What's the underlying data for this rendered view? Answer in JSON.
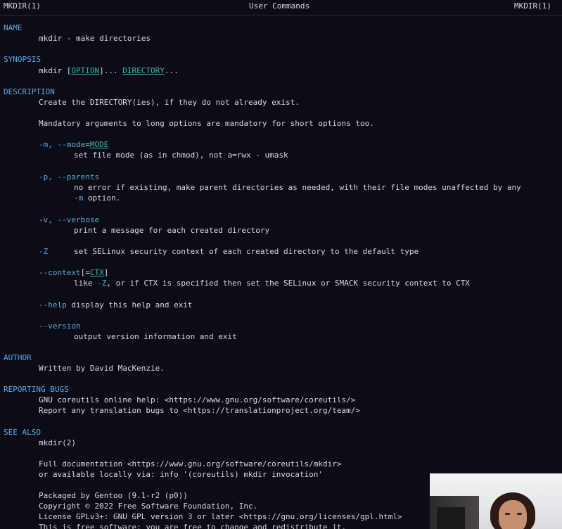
{
  "header": {
    "left": "MKDIR(1)",
    "center": "User Commands",
    "right": "MKDIR(1)"
  },
  "name": {
    "heading": "NAME",
    "text": "mkdir - make directories"
  },
  "synopsis": {
    "heading": "SYNOPSIS",
    "cmd": "mkdir",
    "open": "[",
    "option": "OPTION",
    "close": "]...",
    "directory": "DIRECTORY",
    "ellipsis": "..."
  },
  "description": {
    "heading": "DESCRIPTION",
    "line1": "Create the DIRECTORY(ies), if they do not already exist.",
    "line2": "Mandatory arguments to long options are mandatory for short options too.",
    "mode_flag": "-m, --mode",
    "mode_eq": "=",
    "mode_arg": "MODE",
    "mode_desc": "set file mode (as in chmod), not a=rwx - umask",
    "parents_flag": "-p, --parents",
    "parents_desc1": "no error if existing, make parent directories as needed, with their file modes unaffected by any",
    "parents_desc2_flag": "-m",
    "parents_desc2": " option.",
    "verbose_flag": "-v, --verbose",
    "verbose_desc": "print a message for each created directory",
    "z_flag": "-Z",
    "z_desc": "set SELinux security context of each created directory to the default type",
    "context_flag": "--context",
    "context_open": "[=",
    "context_arg": "CTX",
    "context_close": "]",
    "context_desc_pre": "like ",
    "context_desc_flag": "-Z",
    "context_desc": ", or if CTX is specified then set the SELinux or SMACK security context to CTX",
    "help_flag": "--help",
    "help_desc": " display this help and exit",
    "version_flag": "--version",
    "version_desc": "output version information and exit"
  },
  "author": {
    "heading": "AUTHOR",
    "text": "Written by David MacKenzie."
  },
  "bugs": {
    "heading": "REPORTING BUGS",
    "line1": "GNU coreutils online help: <https://www.gnu.org/software/coreutils/>",
    "line2": "Report any translation bugs to <https://translationproject.org/team/>"
  },
  "see_also": {
    "heading": "SEE ALSO",
    "ref": "mkdir(2)",
    "line1": "Full documentation <https://www.gnu.org/software/coreutils/mkdir>",
    "line2": "or available locally via: info '(coreutils) mkdir invocation'",
    "line3": "Packaged by Gentoo (9.1-r2 (p0))",
    "line4": "Copyright © 2022 Free Software Foundation, Inc.",
    "line5": "License GPLv3+: GNU GPL version 3 or later <https://gnu.org/licenses/gpl.html>",
    "line6": "This is free software: you are free to change and redistribute it."
  },
  "colors": {
    "background": "#0b0c15",
    "text": "#d9d9d9",
    "heading": "#5fa8e0",
    "underline": "#3fb6a8"
  }
}
